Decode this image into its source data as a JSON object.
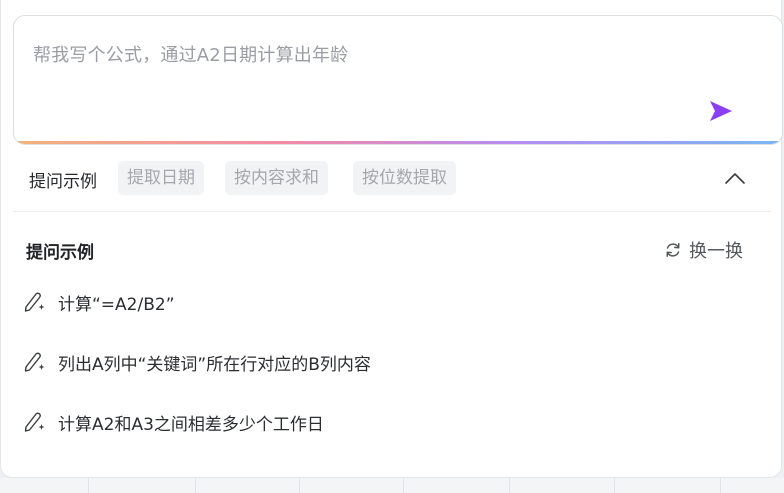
{
  "input": {
    "placeholder": "帮我写个公式，通过A2日期计算出年龄"
  },
  "examples_bar": {
    "title": "提问示例",
    "chips": [
      "提取日期",
      "按内容求和",
      "按位数提取"
    ]
  },
  "section": {
    "title": "提问示例",
    "refresh_label": "换一换"
  },
  "examples": [
    "计算“=A2/B2”",
    "列出A列中“关键词”所在行对应的B列内容",
    "计算A2和A3之间相差多少个工作日"
  ],
  "colors": {
    "send_icon": "#8b3ff5",
    "gradient": [
      "#f2b27a",
      "#f58aa6",
      "#b58cf2",
      "#78b6f5"
    ]
  },
  "icons": {
    "send": "send-icon",
    "collapse": "chevron-up-icon",
    "refresh": "refresh-icon",
    "example": "magic-pen-icon"
  }
}
